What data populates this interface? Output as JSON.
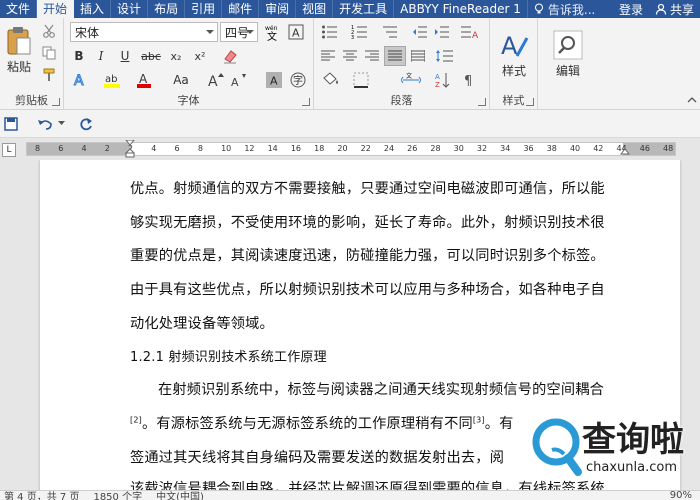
{
  "tabs": [
    "文件",
    "开始",
    "插入",
    "设计",
    "布局",
    "引用",
    "邮件",
    "审阅",
    "视图",
    "开发工具",
    "ABBYY FineReader 1"
  ],
  "active_tab_index": 1,
  "tell_me": "告诉我...",
  "login": "登录",
  "share": "共享",
  "ribbon": {
    "clipboard": {
      "paste_label": "粘贴",
      "group_label": "剪贴板"
    },
    "font": {
      "font_name": "宋体",
      "font_size": "四号",
      "group_label": "字体",
      "aa_label": "Aa"
    },
    "paragraph": {
      "group_label": "段落"
    },
    "styles": {
      "styles_label": "样式",
      "group_label": "样式"
    },
    "editing": {
      "editing_label": "编辑"
    }
  },
  "ruler": {
    "ticks": [
      "8",
      "6",
      "4",
      "2",
      "2",
      "4",
      "6",
      "8",
      "10",
      "12",
      "14",
      "16",
      "18",
      "20",
      "22",
      "24",
      "26",
      "28",
      "30",
      "32",
      "34",
      "36",
      "38",
      "40",
      "42",
      "44",
      "46",
      "48"
    ],
    "left_margin_fraction": 0.16,
    "right_margin_fraction": 0.08
  },
  "document": {
    "lines": [
      "优点。射频通信的双方不需要接触，只要通过空间电磁波即可通信，所以能",
      "够实现无磨损，不受使用环境的影响，延长了寿命。此外，射频识别技术很",
      "重要的优点是，其阅读速度迅速，防碰撞能力强，可以同时识别多个标签。",
      "由于具有这些优点，所以射频识别技术可以应用与多种场合，如各种电子自",
      "动化处理设备等领域。"
    ],
    "heading": "1.2.1 射频识别技术系统工作原理",
    "para2_line1": "在射频识别系统中，标签与阅读器之间通天线实现射频信号的空间耦合",
    "para2_line2_a": "[2]",
    "para2_line2_b": "。有源标签系统与无源标签系统的工作原理稍有不同",
    "para2_line2_c": "[3]",
    "para2_line2_d": "。有",
    "para2_line3": "签通过其天线将其自身编码及需要发送的数据发射出去，阅",
    "para2_line4": "该载波信号耦合到电路，并经芯片解调还原得到需要的信息，有线标签系统"
  },
  "watermark": {
    "brand": "查询啦",
    "domain": "chaxunla.com"
  },
  "status": {
    "page": "第 4 页，共 7 页",
    "words": "1850 个字",
    "lang": "中文(中国)",
    "zoom": "90%"
  },
  "colors": {
    "tab_bar": "#2b579a",
    "ribbon": "#f3f3f3",
    "highlight_yellow": "#ffff00",
    "font_red": "#e00000",
    "watermark_blue": "#2a9ad6"
  }
}
